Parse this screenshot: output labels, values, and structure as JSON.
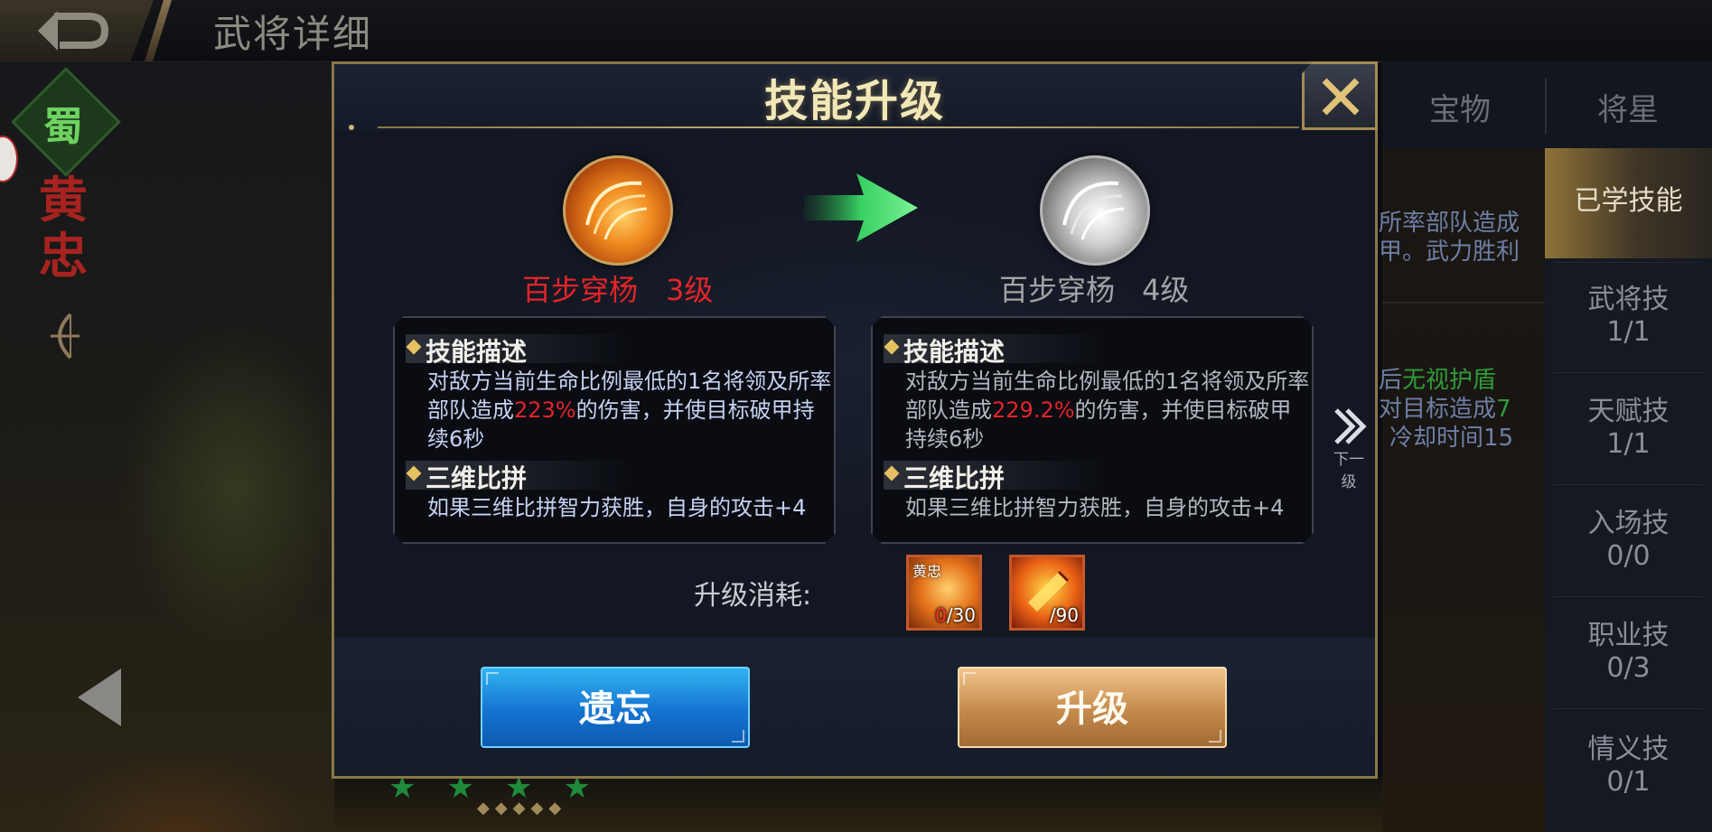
{
  "header": {
    "page_title": "武将详细",
    "back_icon": "back-arrow-icon"
  },
  "hero": {
    "faction": "蜀",
    "name_line1": "黄",
    "name_line2": "忠"
  },
  "right_panel": {
    "tabs": [
      "宝物",
      "将星"
    ],
    "content_lines": [
      {
        "text": "所率部队造成"
      },
      {
        "text": "甲。武力胜利"
      },
      {
        "pre": "后",
        "green": "无视护盾"
      },
      {
        "pre": "对目标造成",
        "green": "7"
      },
      {
        "pre": "冷却时间15"
      }
    ],
    "menu": [
      {
        "label": "已学技能",
        "count": ""
      },
      {
        "label": "武将技",
        "count": "1/1"
      },
      {
        "label": "天赋技",
        "count": "1/1"
      },
      {
        "label": "入场技",
        "count": "0/0"
      },
      {
        "label": "职业技",
        "count": "0/3"
      },
      {
        "label": "情义技",
        "count": "0/1"
      }
    ]
  },
  "modal": {
    "title": "技能升级",
    "current": {
      "name": "百步穿杨",
      "level": "3级"
    },
    "next": {
      "name": "百步穿杨",
      "level": "4级"
    },
    "section_desc": "技能描述",
    "section_compare": "三维比拼",
    "current_desc": {
      "pre": "对敌方当前生命比例最低的1名将领及所率部队造成",
      "value": "223%",
      "post": "的伤害，并使目标破甲持续6秒"
    },
    "next_desc": {
      "pre": "对敌方当前生命比例最低的1名将领及所率部队造成",
      "value": "229.2%",
      "post": "的伤害，并使目标破甲持续6秒"
    },
    "compare_text": "如果三维比拼智力获胜，自身的攻击+4",
    "next_level_label": "下一级",
    "cost_label": "升级消耗:",
    "cost_items": [
      {
        "tag": "黄忠",
        "have": "0",
        "need": "/30"
      },
      {
        "tag": "",
        "have": "",
        "need": "/90"
      }
    ],
    "forget_button": "遗忘",
    "upgrade_button": "升级"
  },
  "colors": {
    "accent_gold": "#c9b57a",
    "red": "#e3252a",
    "green": "#2f9b3a",
    "blue_button": "#1573d1",
    "gold_button": "#c48a4c"
  }
}
